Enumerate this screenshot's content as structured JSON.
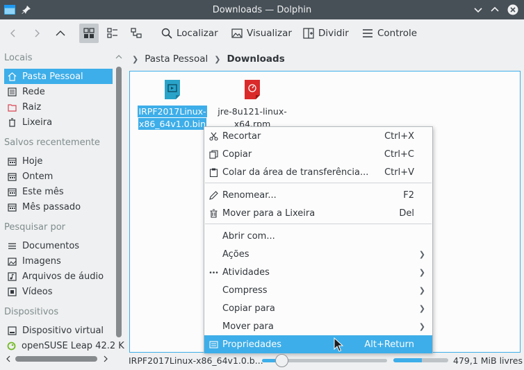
{
  "window": {
    "title": "Downloads — Dolphin"
  },
  "toolbar": {
    "find_label": "Localizar",
    "preview_label": "Visualizar",
    "split_label": "Dividir",
    "control_label": "Controle"
  },
  "sidebar": {
    "places_header": "Locais",
    "places": [
      "Pasta Pessoal",
      "Rede",
      "Raiz",
      "Lixeira"
    ],
    "recent_header": "Salvos recentemente",
    "recent": [
      "Hoje",
      "Ontem",
      "Este mês",
      "Mês passado"
    ],
    "search_header": "Pesquisar por",
    "search": [
      "Documentos",
      "Imagens",
      "Arquivos de áudio",
      "Vídeos"
    ],
    "devices_header": "Dispositivos",
    "devices": [
      "Dispositivo virtual",
      "openSUSE Leap 42.2 K"
    ]
  },
  "breadcrumb": {
    "home": "Pasta Pessoal",
    "current": "Downloads"
  },
  "files": [
    {
      "name_line1": "IRPF2017Linux-",
      "name_line2": "x86_64v1.0.bin",
      "icon": "executable-icon",
      "color": "#2aa3c9"
    },
    {
      "name_line1": "jre-8u121-linux-",
      "name_line2": "x64.rpm",
      "icon": "rpm-package-icon",
      "color": "#da2a2a"
    }
  ],
  "menu": {
    "cut": {
      "label": "Recortar",
      "shortcut": "Ctrl+X"
    },
    "copy": {
      "label": "Copiar",
      "shortcut": "Ctrl+C"
    },
    "paste": {
      "label": "Colar da área de transferência...",
      "shortcut": "Ctrl+V"
    },
    "rename": {
      "label": "Renomear...",
      "shortcut": "F2"
    },
    "trash": {
      "label": "Mover para a Lixeira",
      "shortcut": "Del"
    },
    "open_with": {
      "label": "Abrir com..."
    },
    "actions": {
      "label": "Ações"
    },
    "activities": {
      "label": "Atividades"
    },
    "compress": {
      "label": "Compress"
    },
    "copy_to": {
      "label": "Copiar para"
    },
    "move_to": {
      "label": "Mover para"
    },
    "properties": {
      "label": "Propriedades",
      "shortcut": "Alt+Return"
    }
  },
  "status": {
    "selected_file": "IRPF2017Linux-x86_64v1.0.b...",
    "free_space": "479,1 MiB livres",
    "zoom_fraction": 0.16,
    "disk_used_fraction": 0.52
  },
  "colors": {
    "accent": "#3daee9",
    "titlebar": "#475057"
  }
}
